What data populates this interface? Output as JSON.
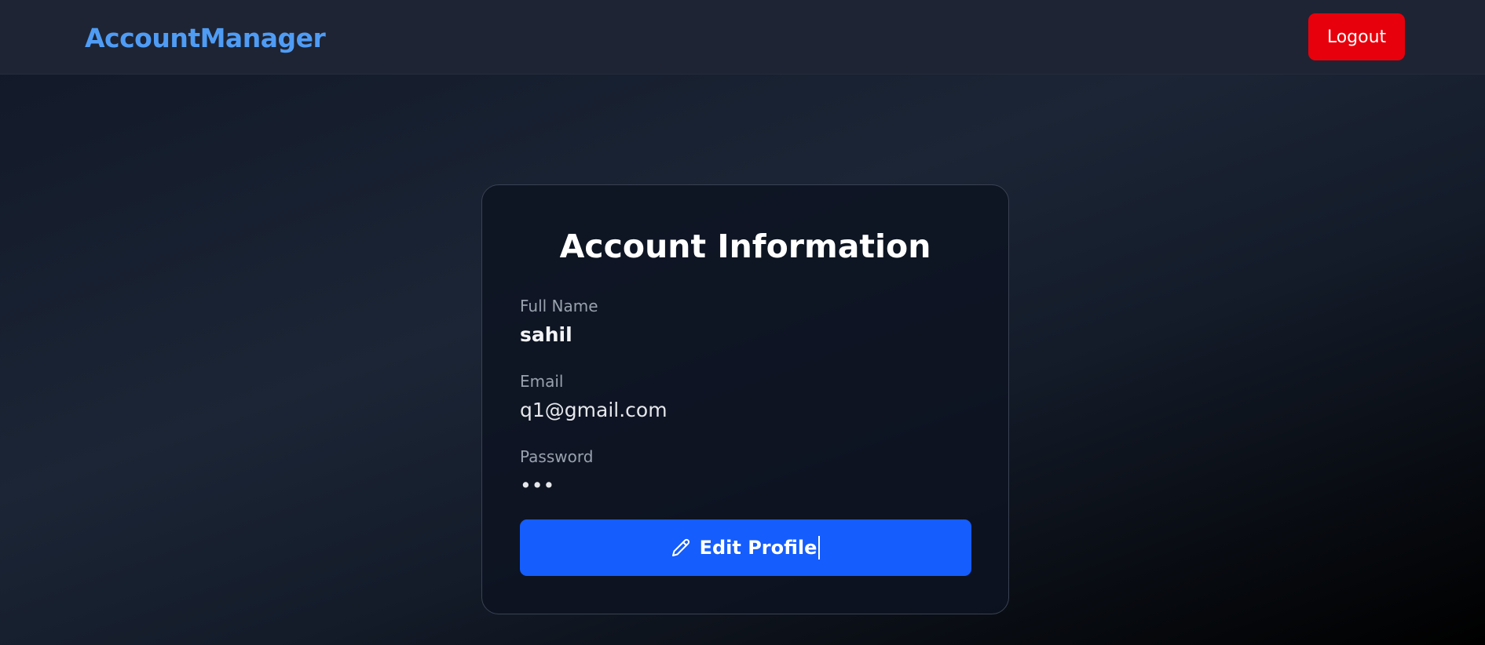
{
  "navbar": {
    "brand": "AccountManager",
    "logout_label": "Logout"
  },
  "account": {
    "title": "Account Information",
    "fields": [
      {
        "label": "Full Name",
        "value": "sahil"
      },
      {
        "label": "Email",
        "value": "q1@gmail.com"
      },
      {
        "label": "Password",
        "value": "•••"
      }
    ],
    "edit_button": {
      "label": "Edit Profile",
      "icon": "pencil-icon"
    }
  },
  "colors": {
    "brand": "#4f9cf5",
    "logout": "#e7000b",
    "primary": "#155dfc",
    "navbar_bg": "#1e2433"
  }
}
